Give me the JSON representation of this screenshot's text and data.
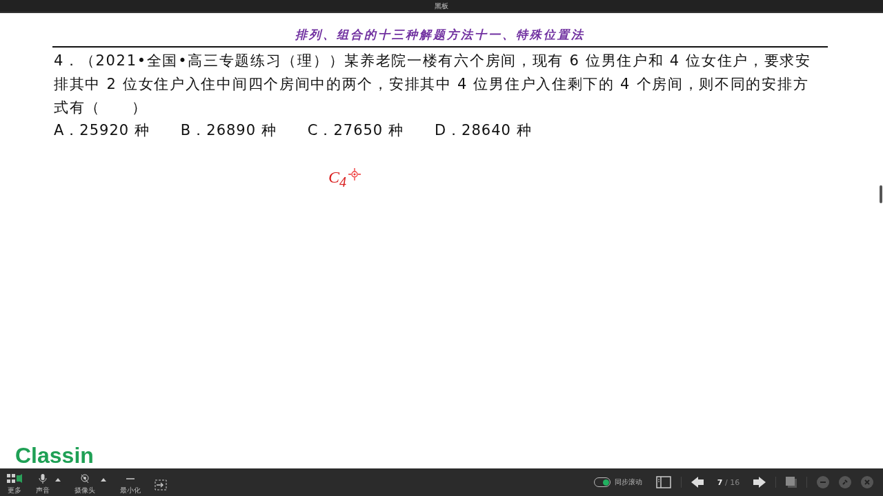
{
  "window": {
    "title": "黑板"
  },
  "board": {
    "heading": "排列、组合的十三种解题方法十一、特殊位置法",
    "question": "4．（2021•全国•高三专题练习（理））某养老院一楼有六个房间，现有 6 位男住户和 4 位女住户，要求安排其中 2 位女住户入住中间四个房间中的两个，安排其中 4 位男住户入住剩下的 4 个房间，则不同的安排方式有（　　）",
    "options": [
      "A．25920 种",
      "B．26890 种",
      "C．27650 种",
      "D．28640 种"
    ],
    "handwriting": "C$_{4}$"
  },
  "logo": "Classin",
  "toolbar": {
    "left": [
      {
        "kind": "more",
        "label": "更多"
      },
      {
        "kind": "mic",
        "label": "声音"
      },
      {
        "kind": "camera",
        "label": "摄像头"
      },
      {
        "kind": "minimize",
        "label": "最小化"
      },
      {
        "kind": "exit"
      }
    ],
    "sync": {
      "label": "同步滚动",
      "on": true
    },
    "page": {
      "current": "7",
      "total": "/ 16"
    }
  }
}
